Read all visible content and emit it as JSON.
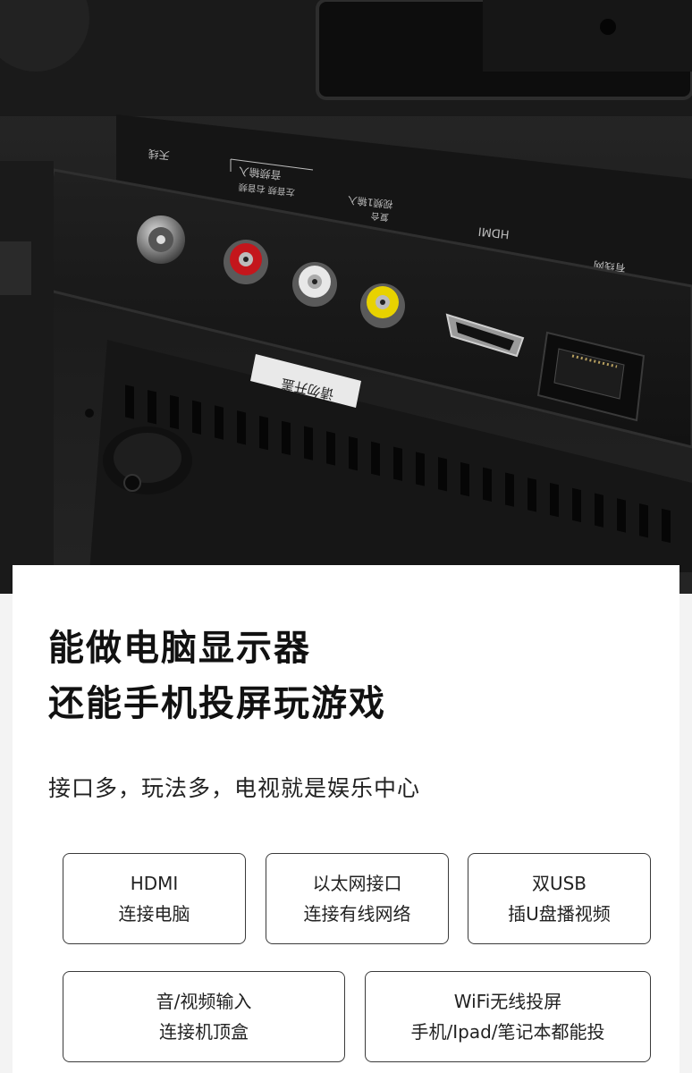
{
  "photo": {
    "panel_labels": {
      "antenna": "天线",
      "audio_in": "音频输入",
      "audio_lr": "左音频 右音频",
      "video_in": "视频1输入",
      "composite": "复合",
      "hdmi": "HDMI",
      "network": "有线网"
    },
    "sticker": "请勿开盖"
  },
  "headline": {
    "line1": "能做电脑显示器",
    "line2": "还能手机投屏玩游戏"
  },
  "subtitle": "接口多，玩法多，电视就是娱乐中心",
  "features": [
    {
      "title": "HDMI",
      "desc": "连接电脑"
    },
    {
      "title": "以太网接口",
      "desc": "连接有线网络"
    },
    {
      "title": "双USB",
      "desc": "插U盘播视频"
    },
    {
      "title": "音/视频输入",
      "desc": "连接机顶盒"
    },
    {
      "title": "WiFi无线投屏",
      "desc": "手机/Ipad/笔记本都能投"
    }
  ],
  "colors": {
    "card_bg": "#ffffff",
    "page_bg": "#f3f3f3",
    "text": "#111111",
    "port_red": "#c4161c",
    "port_white": "#e8e8e8",
    "port_yellow": "#e8d200"
  }
}
